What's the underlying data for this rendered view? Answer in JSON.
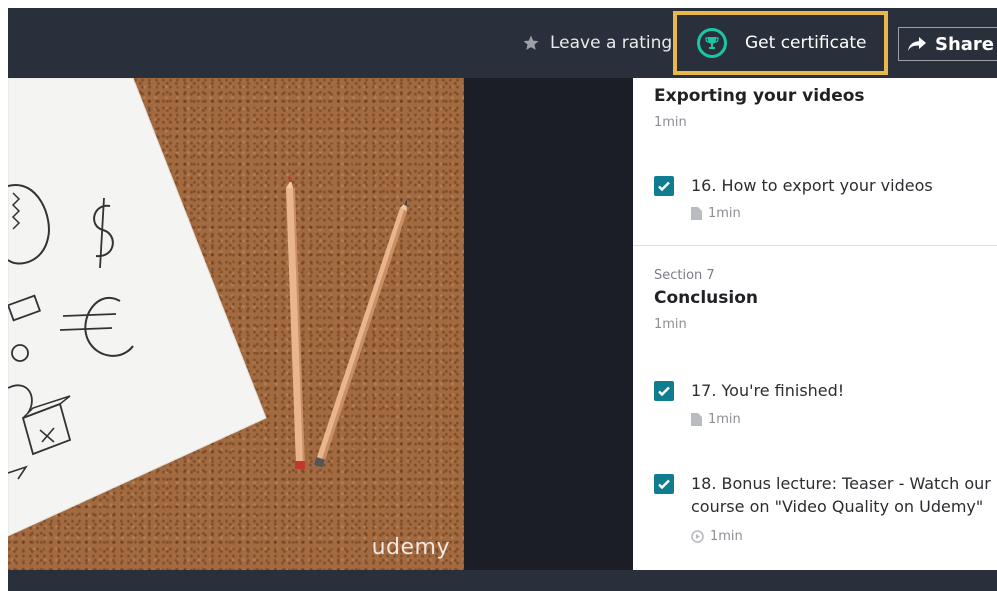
{
  "header": {
    "rating_label": "Leave a rating",
    "certificate_label": "Get certificate",
    "share_label": "Share"
  },
  "video": {
    "watermark": "udemy"
  },
  "curriculum": {
    "section6": {
      "title": "Exporting your videos",
      "duration": "1min"
    },
    "lectures_s6": [
      {
        "title": "16. How to export your videos",
        "duration": "1min",
        "type": "document",
        "completed": true
      }
    ],
    "section7": {
      "number": "Section 7",
      "title": "Conclusion",
      "duration": "1min"
    },
    "lectures_s7": [
      {
        "title": "17. You're finished!",
        "duration": "1min",
        "type": "document",
        "completed": true
      },
      {
        "title": "18. Bonus lecture: Teaser - Watch our course on \"Video Quality on Udemy\"",
        "duration": "1min",
        "type": "video",
        "completed": true
      }
    ]
  },
  "colors": {
    "topbar": "#29303b",
    "certificate_highlight": "#e8b94a",
    "trophy_accent": "#1bc6a4",
    "checkbox": "#0f7c90"
  },
  "icons": {
    "rating": "star-icon",
    "certificate": "trophy-icon",
    "share": "share-arrow-icon",
    "lecture_document": "file-icon",
    "lecture_video": "play-circle-icon",
    "completed": "checkmark-icon"
  }
}
